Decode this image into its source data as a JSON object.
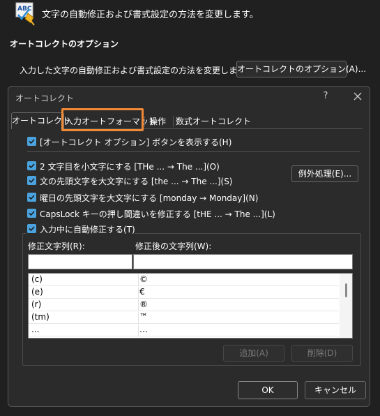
{
  "background": {
    "description": "文字の自動修正および書式設定の方法を変更します。",
    "section_title": "オートコレクトのオプション",
    "autocorrect_row_label": "入力した文字の自動修正および書式設定の方法を変更します:",
    "autocorrect_options_button": "オートコレクトのオプション(A)...",
    "icon_text": "ABC"
  },
  "dialog": {
    "title": "オートコレクト",
    "help_label": "?",
    "tabs": [
      {
        "label": "オートコレクト",
        "selected": true
      },
      {
        "label": "入力オートフォーマット",
        "highlighted": true
      },
      {
        "label": "操作"
      },
      {
        "label": "数式オートコレクト"
      }
    ],
    "show_options_checkbox": "[オートコレクト オプション] ボタンを表示する(H)",
    "checkboxes": [
      {
        "label": "2 文字目を小文字にする [THe ... → The ...](O)",
        "checked": true
      },
      {
        "label": "文の先頭文字を大文字にする [the ... → The ...](S)",
        "checked": true
      },
      {
        "label": "曜日の先頭文字を大文字にする [monday → Monday](N)",
        "checked": true
      },
      {
        "label": "CapsLock キーの押し間違いを修正する [tHE ... → The ...](L)",
        "checked": true
      },
      {
        "label": "入力中に自動修正する(T)",
        "checked": true
      }
    ],
    "exceptions_button": "例外処理(E)...",
    "replace_label": "修正文字列(R):",
    "with_label": "修正後の文字列(W):",
    "replace_value": "",
    "with_value": "",
    "list": [
      {
        "from": "(c)",
        "to": "©"
      },
      {
        "from": "(e)",
        "to": "€"
      },
      {
        "from": "(r)",
        "to": "®"
      },
      {
        "from": "(tm)",
        "to": "™"
      },
      {
        "from": "...",
        "to": "…"
      }
    ],
    "add_button": "追加(A)",
    "delete_button": "削除(D)",
    "ok_button": "OK",
    "cancel_button": "キャンセル"
  },
  "colors": {
    "page_bg": "#202020",
    "dialog_bg": "#2b2b2b",
    "checkbox_accent": "#4aa3df",
    "tab_highlight": "#f08a36"
  }
}
